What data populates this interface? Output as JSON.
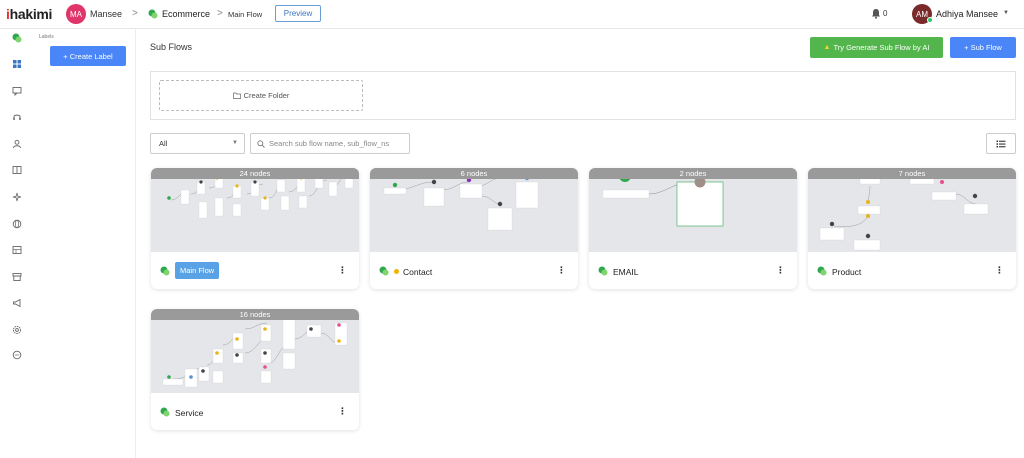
{
  "brand": {
    "logo_text": "hakimi",
    "logo_prefix": "i"
  },
  "header": {
    "workspace_avatar": "MA",
    "workspace_name": "Mansee",
    "breadcrumb_sep": ">",
    "bot_name": "Ecommerce",
    "flow_name": "Main Flow",
    "preview_label": "Preview",
    "notification_count": "0",
    "user_avatar": "AM",
    "user_name": "Adhiya Mansee"
  },
  "label_panel": {
    "title": "Labels",
    "create_label": "+ Create Label"
  },
  "main": {
    "title": "Sub Flows",
    "ai_button": "Try Generate Sub Flow by AI",
    "subflow_button": "+ Sub Flow",
    "create_folder": "Create Folder",
    "filter_value": "All",
    "search_placeholder": "Search sub flow name, sub_flow_ns"
  },
  "cards": [
    {
      "nodes": "24 nodes",
      "name": "Main Flow"
    },
    {
      "nodes": "6 nodes",
      "name": "Contact"
    },
    {
      "nodes": "2 nodes",
      "name": "EMAIL"
    },
    {
      "nodes": "7 nodes",
      "name": "Product"
    },
    {
      "nodes": "16 nodes",
      "name": "Service"
    }
  ],
  "colors": {
    "accent_blue": "#4a86f7",
    "ai_green": "#53b64c",
    "brand_red": "#e6312e"
  }
}
